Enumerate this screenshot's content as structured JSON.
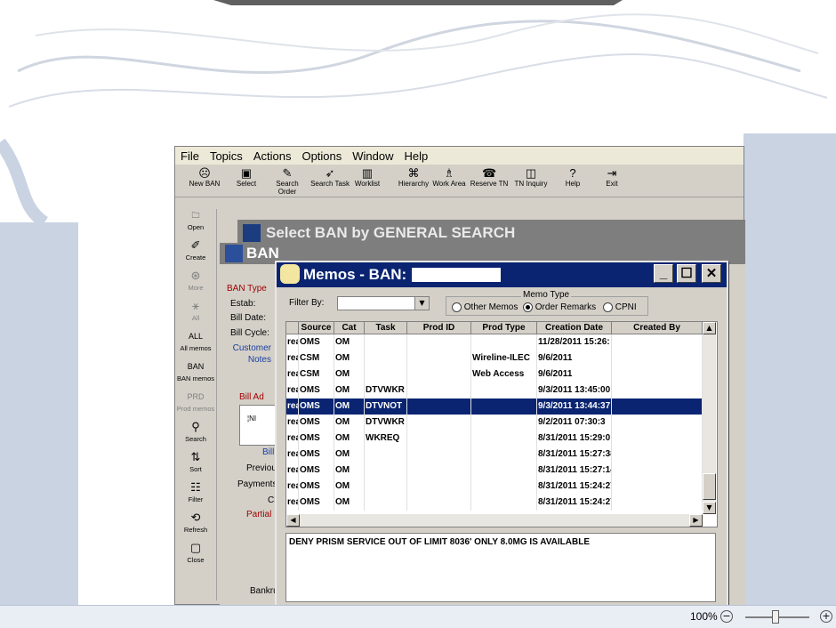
{
  "menubar": [
    "File",
    "Topics",
    "Actions",
    "Options",
    "Window",
    "Help"
  ],
  "toolbar": [
    {
      "label": "New BAN",
      "icon": "new-ban-icon",
      "glyph": "☹"
    },
    {
      "label": "Select",
      "icon": "select-icon",
      "glyph": "▣"
    },
    {
      "label": "Search Order",
      "icon": "search-order-icon",
      "glyph": "✎"
    },
    {
      "label": "Search Task",
      "icon": "search-task-icon",
      "glyph": "➶"
    },
    {
      "label": "Worklist",
      "icon": "worklist-icon",
      "glyph": "▥"
    },
    {
      "label": "Hierarchy",
      "icon": "hierarchy-icon",
      "glyph": "⌘"
    },
    {
      "label": "Work Area",
      "icon": "work-area-icon",
      "glyph": "♗"
    },
    {
      "label": "Reserve TN",
      "icon": "phone-icon",
      "glyph": "☎"
    },
    {
      "label": "TN Inquiry",
      "icon": "tn-inquiry-icon",
      "glyph": "◫"
    },
    {
      "label": "Help",
      "icon": "help-icon",
      "glyph": "?"
    },
    {
      "label": "Exit",
      "icon": "exit-icon",
      "glyph": "⇥"
    }
  ],
  "sidebar": [
    {
      "label": "Open",
      "icon": "open-folder-icon",
      "glyph": "🗀",
      "enabled": true
    },
    {
      "label": "Create",
      "icon": "create-icon",
      "glyph": "✐",
      "enabled": true
    },
    {
      "label": "More",
      "icon": "more-icon",
      "glyph": "⊛",
      "enabled": false
    },
    {
      "label": "All",
      "icon": "all-icon",
      "glyph": "⚹",
      "enabled": false
    },
    {
      "label": "All memos",
      "icon": "all-memos-icon",
      "glyph": "ALL",
      "enabled": true
    },
    {
      "label": "BAN memos",
      "icon": "ban-memos-icon",
      "glyph": "BAN",
      "enabled": true
    },
    {
      "label": "Prod memos",
      "icon": "prod-memos-icon",
      "glyph": "PRD",
      "enabled": false
    },
    {
      "label": "Search",
      "icon": "search-icon",
      "glyph": "⚲",
      "enabled": true
    },
    {
      "label": "Sort",
      "icon": "sort-icon",
      "glyph": "⇅",
      "enabled": true
    },
    {
      "label": "Filter",
      "icon": "filter-icon",
      "glyph": "☷",
      "enabled": true
    },
    {
      "label": "Refresh",
      "icon": "refresh-icon",
      "glyph": "⟲",
      "enabled": true
    },
    {
      "label": "Close",
      "icon": "close-doc-icon",
      "glyph": "▢",
      "enabled": true
    }
  ],
  "select_ban_title": "Select BAN by GENERAL SEARCH",
  "ban_window": {
    "title": "BAN",
    "labels": {
      "ban_type": "BAN Type",
      "estab": "Estab:",
      "bill_date": "Bill Date:",
      "bill_cycle": "Bill Cycle:",
      "customer_notes": "Customer Notes",
      "bill_address": "Bill Ad",
      "bill": "Bill",
      "previous": "Previou",
      "payments": "Payments",
      "ch": "Cl",
      "partial": "Partial",
      "bankru": "Bankru",
      "small_text": "¦NI"
    }
  },
  "memos": {
    "title": "Memos  - BAN:",
    "filter_label": "Filter By:",
    "filter_value": "",
    "memo_type_label": "Memo Type",
    "radio_options": [
      {
        "label": "Other Memos",
        "checked": false
      },
      {
        "label": "Order Remarks",
        "checked": true
      },
      {
        "label": "CPNI",
        "checked": false
      }
    ],
    "columns": [
      "Source",
      "Cat",
      "Task",
      "Prod ID",
      "Prod Type",
      "Creation Date",
      "Created By"
    ],
    "rows": [
      {
        "pre": "rea",
        "source": "OMS",
        "cat": "OM",
        "task": "",
        "prod_id": "",
        "prod_type": "",
        "date": "11/28/2011 15:26:",
        "by": "",
        "selected": false
      },
      {
        "pre": "rea",
        "source": "CSM",
        "cat": "OM",
        "task": "",
        "prod_id": "",
        "prod_type": "Wireline-ILEC",
        "date": "9/6/2011",
        "by": "",
        "selected": false
      },
      {
        "pre": "rea",
        "source": "CSM",
        "cat": "OM",
        "task": "",
        "prod_id": "",
        "prod_type": "Web Access",
        "date": "9/6/2011",
        "by": "",
        "selected": false
      },
      {
        "pre": "rea",
        "source": "OMS",
        "cat": "OM",
        "task": "DTVWKR",
        "prod_id": "",
        "prod_type": "",
        "date": "9/3/2011 13:45:00",
        "by": "",
        "selected": false
      },
      {
        "pre": "rea",
        "source": "OMS",
        "cat": "OM",
        "task": "DTVNOT",
        "prod_id": "",
        "prod_type": "",
        "date": "9/3/2011 13:44:37",
        "by": "",
        "selected": true
      },
      {
        "pre": "rea",
        "source": "OMS",
        "cat": "OM",
        "task": "DTVWKR",
        "prod_id": "",
        "prod_type": "",
        "date": "9/2/2011 07:30:3",
        "by": "",
        "selected": false
      },
      {
        "pre": "rea",
        "source": "OMS",
        "cat": "OM",
        "task": "WKREQ",
        "prod_id": "",
        "prod_type": "",
        "date": "8/31/2011 15:29:0",
        "by": "",
        "selected": false
      },
      {
        "pre": "rea",
        "source": "OMS",
        "cat": "OM",
        "task": "",
        "prod_id": "",
        "prod_type": "",
        "date": "8/31/2011 15:27:38",
        "by": "",
        "selected": false
      },
      {
        "pre": "rea",
        "source": "OMS",
        "cat": "OM",
        "task": "",
        "prod_id": "",
        "prod_type": "",
        "date": "8/31/2011 15:27:14",
        "by": "",
        "selected": false
      },
      {
        "pre": "rea",
        "source": "OMS",
        "cat": "OM",
        "task": "",
        "prod_id": "",
        "prod_type": "",
        "date": "8/31/2011 15:24:27",
        "by": "",
        "selected": false
      },
      {
        "pre": "rea",
        "source": "OMS",
        "cat": "OM",
        "task": "",
        "prod_id": "",
        "prod_type": "",
        "date": "8/31/2011 15:24:27",
        "by": "",
        "selected": false
      }
    ],
    "memo_text": "DENY PRISM SERVICE OUT OF LIMIT 8036' ONLY 8.0MG IS AVAILABLE"
  },
  "statusbar": {
    "zoom": "100%",
    "zoom_out": "−",
    "zoom_in": "+"
  },
  "colors": {
    "title_active": "#0a2471",
    "title_inactive": "#7e7e7e",
    "selection": "#0a2471"
  }
}
